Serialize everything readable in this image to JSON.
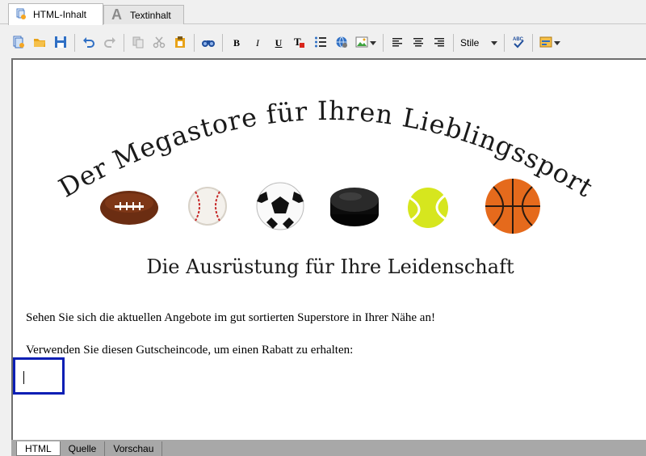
{
  "tabs": [
    {
      "label": "HTML-Inhalt",
      "icon": "html-content-icon",
      "active": true
    },
    {
      "label": "Textinhalt",
      "icon": "text-content-icon",
      "active": false
    }
  ],
  "toolbar": {
    "bold": "B",
    "italic": "I",
    "underline": "U",
    "style_label": "Stile"
  },
  "content": {
    "headline": "Der Megastore für Ihren Lieblingssport",
    "subtitle": "Die Ausrüstung für Ihre Leidenschaft",
    "paragraph1": "Sehen Sie sich die aktuellen Angebote im gut sortierten Superstore in Ihrer Nähe an!",
    "paragraph2": "Verwenden Sie diesen Gutscheincode, um einen Rabatt zu erhalten:",
    "balls": [
      "american-football",
      "baseball",
      "soccer-ball",
      "hockey-puck",
      "tennis-ball",
      "basketball"
    ]
  },
  "bottom_tabs": [
    {
      "label": "HTML",
      "active": true
    },
    {
      "label": "Quelle",
      "active": false
    },
    {
      "label": "Vorschau",
      "active": false
    }
  ],
  "colors": {
    "coupon_border": "#0a1eb4",
    "accent_blue": "#1f5fbf",
    "folder_yellow": "#e8a319"
  }
}
